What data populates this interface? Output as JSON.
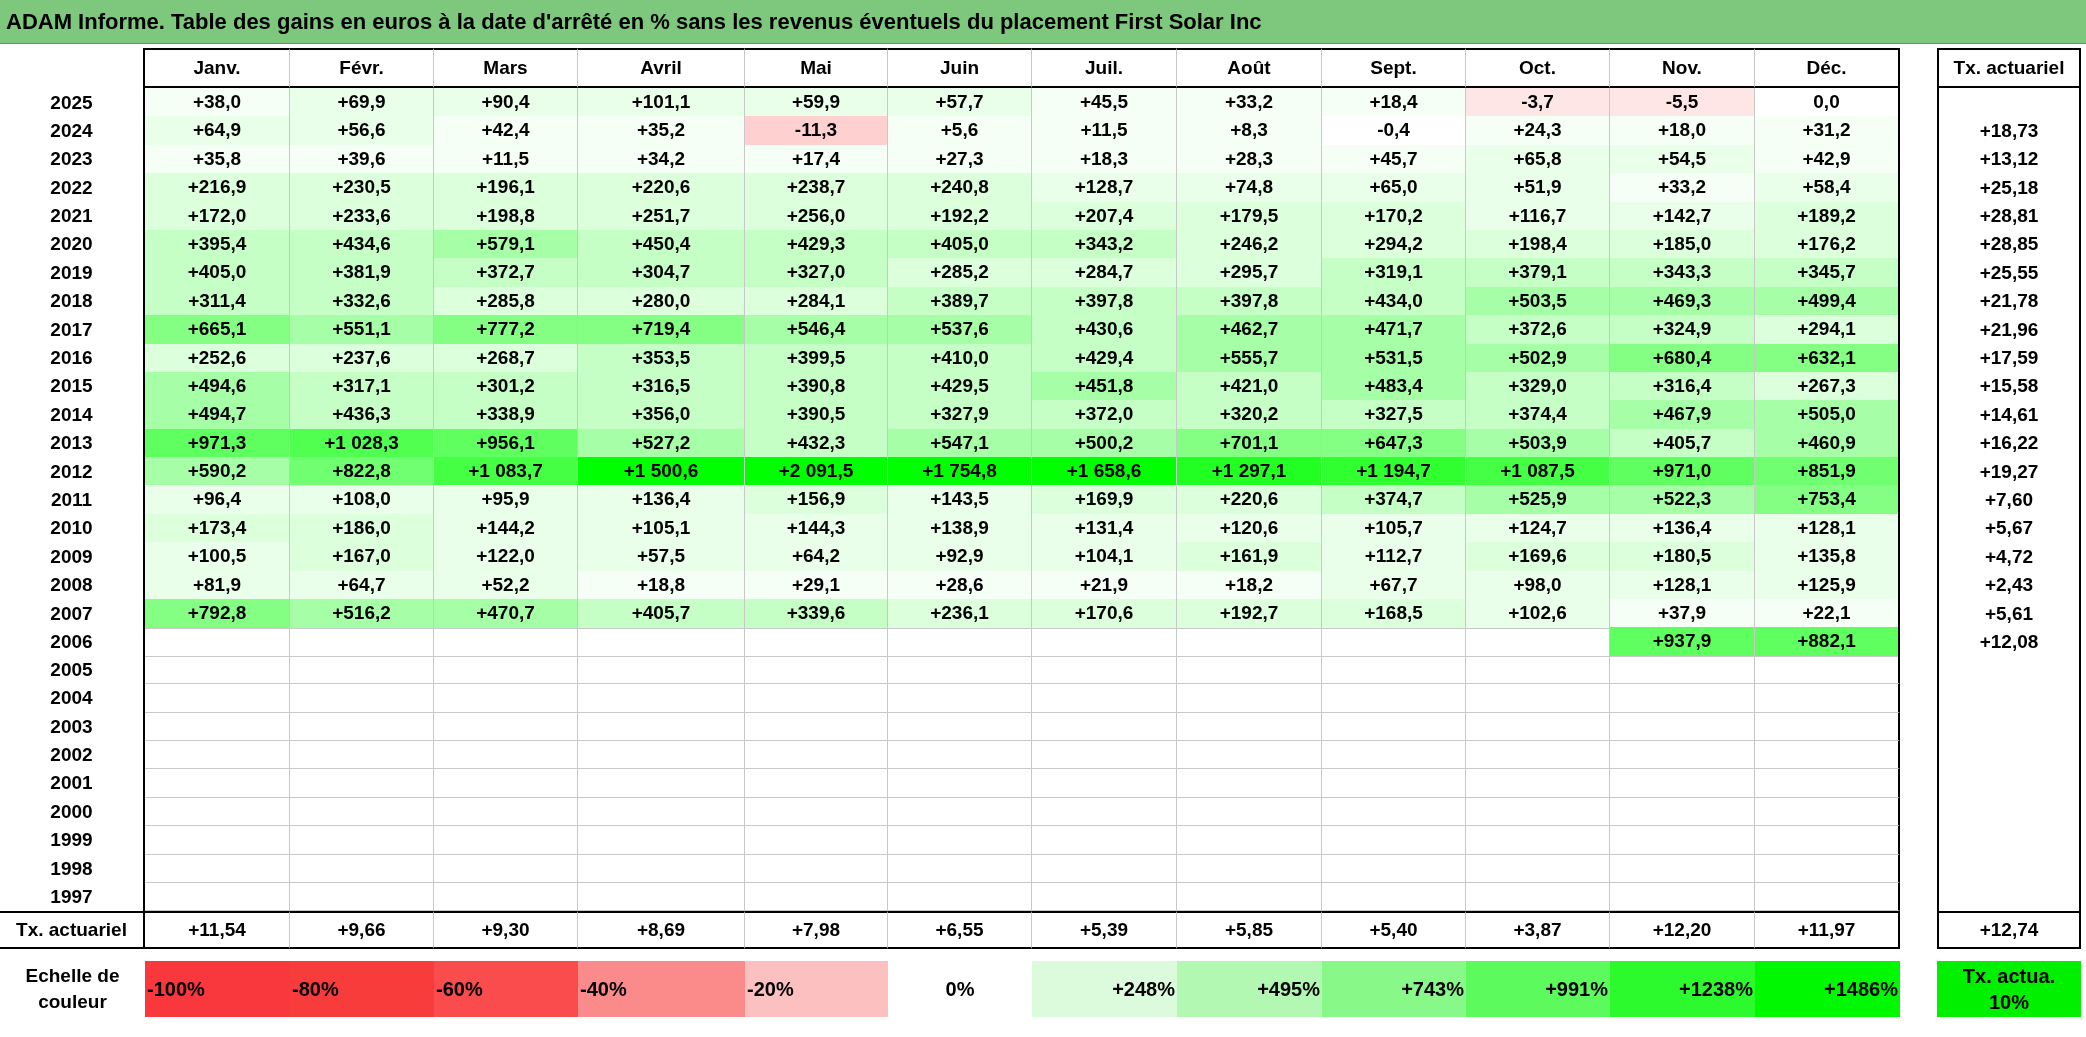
{
  "title": "ADAM Informe. Table des gains en euros à la date d'arrêté en % sans les revenus éventuels du placement First Solar Inc",
  "columns": [
    "Janv.",
    "Févr.",
    "Mars",
    "Avril",
    "Mai",
    "Juin",
    "Juil.",
    "Août",
    "Sept.",
    "Oct.",
    "Nov.",
    "Déc."
  ],
  "tx_header": "Tx. actuariel",
  "rows": [
    {
      "year": "2025",
      "cells": [
        {
          "v": "+38,0",
          "color": "#f6fff6"
        },
        {
          "v": "+69,9",
          "color": "#eaffea"
        },
        {
          "v": "+90,4",
          "color": "#eaffea"
        },
        {
          "v": "+101,1",
          "color": "#eaffea"
        },
        {
          "v": "+59,9",
          "color": "#eaffea"
        },
        {
          "v": "+57,7",
          "color": "#eaffea"
        },
        {
          "v": "+45,5",
          "color": "#f6fff6"
        },
        {
          "v": "+33,2",
          "color": "#f6fff6"
        },
        {
          "v": "+18,4",
          "color": "#f6fff6"
        },
        {
          "v": "-3,7",
          "color": "#ffe6e6"
        },
        {
          "v": "-5,5",
          "color": "#ffe6e6"
        },
        {
          "v": "0,0",
          "color": "#ffffff"
        }
      ]
    },
    {
      "year": "2024",
      "cells": [
        {
          "v": "+64,9",
          "color": "#eaffea"
        },
        {
          "v": "+56,6",
          "color": "#eaffea"
        },
        {
          "v": "+42,4",
          "color": "#f6fff6"
        },
        {
          "v": "+35,2",
          "color": "#f6fff6"
        },
        {
          "v": "-11,3",
          "color": "#ffd0d0"
        },
        {
          "v": "+5,6",
          "color": "#f6fff6"
        },
        {
          "v": "+11,5",
          "color": "#f6fff6"
        },
        {
          "v": "+8,3",
          "color": "#f6fff6"
        },
        {
          "v": "-0,4",
          "color": "#ffffff"
        },
        {
          "v": "+24,3",
          "color": "#f6fff6"
        },
        {
          "v": "+18,0",
          "color": "#f6fff6"
        },
        {
          "v": "+31,2",
          "color": "#f6fff6"
        }
      ],
      "tx": "+18,73"
    },
    {
      "year": "2023",
      "cells": [
        {
          "v": "+35,8",
          "color": "#f6fff6"
        },
        {
          "v": "+39,6",
          "color": "#f6fff6"
        },
        {
          "v": "+11,5",
          "color": "#f6fff6"
        },
        {
          "v": "+34,2",
          "color": "#f6fff6"
        },
        {
          "v": "+17,4",
          "color": "#f6fff6"
        },
        {
          "v": "+27,3",
          "color": "#f6fff6"
        },
        {
          "v": "+18,3",
          "color": "#f6fff6"
        },
        {
          "v": "+28,3",
          "color": "#f6fff6"
        },
        {
          "v": "+45,7",
          "color": "#f6fff6"
        },
        {
          "v": "+65,8",
          "color": "#eaffea"
        },
        {
          "v": "+54,5",
          "color": "#eaffea"
        },
        {
          "v": "+42,9",
          "color": "#f6fff6"
        }
      ],
      "tx": "+13,12"
    },
    {
      "year": "2022",
      "cells": [
        {
          "v": "+216,9",
          "color": "#dcffdc"
        },
        {
          "v": "+230,5",
          "color": "#dcffdc"
        },
        {
          "v": "+196,1",
          "color": "#dcffdc"
        },
        {
          "v": "+220,6",
          "color": "#dcffdc"
        },
        {
          "v": "+238,7",
          "color": "#dcffdc"
        },
        {
          "v": "+240,8",
          "color": "#dcffdc"
        },
        {
          "v": "+128,7",
          "color": "#eaffea"
        },
        {
          "v": "+74,8",
          "color": "#eaffea"
        },
        {
          "v": "+65,0",
          "color": "#eaffea"
        },
        {
          "v": "+51,9",
          "color": "#eaffea"
        },
        {
          "v": "+33,2",
          "color": "#f6fff6"
        },
        {
          "v": "+58,4",
          "color": "#eaffea"
        }
      ],
      "tx": "+25,18"
    },
    {
      "year": "2021",
      "cells": [
        {
          "v": "+172,0",
          "color": "#dcffdc"
        },
        {
          "v": "+233,6",
          "color": "#dcffdc"
        },
        {
          "v": "+198,8",
          "color": "#dcffdc"
        },
        {
          "v": "+251,7",
          "color": "#dcffdc"
        },
        {
          "v": "+256,0",
          "color": "#dcffdc"
        },
        {
          "v": "+192,2",
          "color": "#dcffdc"
        },
        {
          "v": "+207,4",
          "color": "#dcffdc"
        },
        {
          "v": "+179,5",
          "color": "#dcffdc"
        },
        {
          "v": "+170,2",
          "color": "#dcffdc"
        },
        {
          "v": "+116,7",
          "color": "#eaffea"
        },
        {
          "v": "+142,7",
          "color": "#eaffea"
        },
        {
          "v": "+189,2",
          "color": "#dcffdc"
        }
      ],
      "tx": "+28,81"
    },
    {
      "year": "2020",
      "cells": [
        {
          "v": "+395,4",
          "color": "#c6ffc6"
        },
        {
          "v": "+434,6",
          "color": "#c6ffc6"
        },
        {
          "v": "+579,1",
          "color": "#a6ffa6"
        },
        {
          "v": "+450,4",
          "color": "#c6ffc6"
        },
        {
          "v": "+429,3",
          "color": "#c6ffc6"
        },
        {
          "v": "+405,0",
          "color": "#c6ffc6"
        },
        {
          "v": "+343,2",
          "color": "#c6ffc6"
        },
        {
          "v": "+246,2",
          "color": "#dcffdc"
        },
        {
          "v": "+294,2",
          "color": "#dcffdc"
        },
        {
          "v": "+198,4",
          "color": "#dcffdc"
        },
        {
          "v": "+185,0",
          "color": "#dcffdc"
        },
        {
          "v": "+176,2",
          "color": "#dcffdc"
        }
      ],
      "tx": "+28,85"
    },
    {
      "year": "2019",
      "cells": [
        {
          "v": "+405,0",
          "color": "#c6ffc6"
        },
        {
          "v": "+381,9",
          "color": "#c6ffc6"
        },
        {
          "v": "+372,7",
          "color": "#c6ffc6"
        },
        {
          "v": "+304,7",
          "color": "#c6ffc6"
        },
        {
          "v": "+327,0",
          "color": "#c6ffc6"
        },
        {
          "v": "+285,2",
          "color": "#dcffdc"
        },
        {
          "v": "+284,7",
          "color": "#dcffdc"
        },
        {
          "v": "+295,7",
          "color": "#dcffdc"
        },
        {
          "v": "+319,1",
          "color": "#c6ffc6"
        },
        {
          "v": "+379,1",
          "color": "#c6ffc6"
        },
        {
          "v": "+343,3",
          "color": "#c6ffc6"
        },
        {
          "v": "+345,7",
          "color": "#c6ffc6"
        }
      ],
      "tx": "+25,55"
    },
    {
      "year": "2018",
      "cells": [
        {
          "v": "+311,4",
          "color": "#c6ffc6"
        },
        {
          "v": "+332,6",
          "color": "#c6ffc6"
        },
        {
          "v": "+285,8",
          "color": "#dcffdc"
        },
        {
          "v": "+280,0",
          "color": "#dcffdc"
        },
        {
          "v": "+284,1",
          "color": "#dcffdc"
        },
        {
          "v": "+389,7",
          "color": "#c6ffc6"
        },
        {
          "v": "+397,8",
          "color": "#c6ffc6"
        },
        {
          "v": "+397,8",
          "color": "#c6ffc6"
        },
        {
          "v": "+434,0",
          "color": "#c6ffc6"
        },
        {
          "v": "+503,5",
          "color": "#a6ffa6"
        },
        {
          "v": "+469,3",
          "color": "#a6ffa6"
        },
        {
          "v": "+499,4",
          "color": "#a6ffa6"
        }
      ],
      "tx": "+21,78"
    },
    {
      "year": "2017",
      "cells": [
        {
          "v": "+665,1",
          "color": "#84ff84"
        },
        {
          "v": "+551,1",
          "color": "#a6ffa6"
        },
        {
          "v": "+777,2",
          "color": "#84ff84"
        },
        {
          "v": "+719,4",
          "color": "#84ff84"
        },
        {
          "v": "+546,4",
          "color": "#a6ffa6"
        },
        {
          "v": "+537,6",
          "color": "#a6ffa6"
        },
        {
          "v": "+430,6",
          "color": "#c6ffc6"
        },
        {
          "v": "+462,7",
          "color": "#a6ffa6"
        },
        {
          "v": "+471,7",
          "color": "#a6ffa6"
        },
        {
          "v": "+372,6",
          "color": "#c6ffc6"
        },
        {
          "v": "+324,9",
          "color": "#c6ffc6"
        },
        {
          "v": "+294,1",
          "color": "#dcffdc"
        }
      ],
      "tx": "+21,96"
    },
    {
      "year": "2016",
      "cells": [
        {
          "v": "+252,6",
          "color": "#dcffdc"
        },
        {
          "v": "+237,6",
          "color": "#dcffdc"
        },
        {
          "v": "+268,7",
          "color": "#dcffdc"
        },
        {
          "v": "+353,5",
          "color": "#c6ffc6"
        },
        {
          "v": "+399,5",
          "color": "#c6ffc6"
        },
        {
          "v": "+410,0",
          "color": "#c6ffc6"
        },
        {
          "v": "+429,4",
          "color": "#c6ffc6"
        },
        {
          "v": "+555,7",
          "color": "#a6ffa6"
        },
        {
          "v": "+531,5",
          "color": "#a6ffa6"
        },
        {
          "v": "+502,9",
          "color": "#a6ffa6"
        },
        {
          "v": "+680,4",
          "color": "#84ff84"
        },
        {
          "v": "+632,1",
          "color": "#84ff84"
        }
      ],
      "tx": "+17,59"
    },
    {
      "year": "2015",
      "cells": [
        {
          "v": "+494,6",
          "color": "#a6ffa6"
        },
        {
          "v": "+317,1",
          "color": "#c6ffc6"
        },
        {
          "v": "+301,2",
          "color": "#c6ffc6"
        },
        {
          "v": "+316,5",
          "color": "#c6ffc6"
        },
        {
          "v": "+390,8",
          "color": "#c6ffc6"
        },
        {
          "v": "+429,5",
          "color": "#c6ffc6"
        },
        {
          "v": "+451,8",
          "color": "#a6ffa6"
        },
        {
          "v": "+421,0",
          "color": "#c6ffc6"
        },
        {
          "v": "+483,4",
          "color": "#a6ffa6"
        },
        {
          "v": "+329,0",
          "color": "#c6ffc6"
        },
        {
          "v": "+316,4",
          "color": "#c6ffc6"
        },
        {
          "v": "+267,3",
          "color": "#dcffdc"
        }
      ],
      "tx": "+15,58"
    },
    {
      "year": "2014",
      "cells": [
        {
          "v": "+494,7",
          "color": "#a6ffa6"
        },
        {
          "v": "+436,3",
          "color": "#c6ffc6"
        },
        {
          "v": "+338,9",
          "color": "#c6ffc6"
        },
        {
          "v": "+356,0",
          "color": "#c6ffc6"
        },
        {
          "v": "+390,5",
          "color": "#c6ffc6"
        },
        {
          "v": "+327,9",
          "color": "#c6ffc6"
        },
        {
          "v": "+372,0",
          "color": "#c6ffc6"
        },
        {
          "v": "+320,2",
          "color": "#c6ffc6"
        },
        {
          "v": "+327,5",
          "color": "#c6ffc6"
        },
        {
          "v": "+374,4",
          "color": "#c6ffc6"
        },
        {
          "v": "+467,9",
          "color": "#a6ffa6"
        },
        {
          "v": "+505,0",
          "color": "#a6ffa6"
        }
      ],
      "tx": "+14,61"
    },
    {
      "year": "2013",
      "cells": [
        {
          "v": "+971,3",
          "color": "#60ff60"
        },
        {
          "v": "+1 028,3",
          "color": "#50ff50"
        },
        {
          "v": "+956,1",
          "color": "#60ff60"
        },
        {
          "v": "+527,2",
          "color": "#a6ffa6"
        },
        {
          "v": "+432,3",
          "color": "#c6ffc6"
        },
        {
          "v": "+547,1",
          "color": "#a6ffa6"
        },
        {
          "v": "+500,2",
          "color": "#a6ffa6"
        },
        {
          "v": "+701,1",
          "color": "#84ff84"
        },
        {
          "v": "+647,3",
          "color": "#84ff84"
        },
        {
          "v": "+503,9",
          "color": "#a6ffa6"
        },
        {
          "v": "+405,7",
          "color": "#c6ffc6"
        },
        {
          "v": "+460,9",
          "color": "#a6ffa6"
        }
      ],
      "tx": "+16,22"
    },
    {
      "year": "2012",
      "cells": [
        {
          "v": "+590,2",
          "color": "#a6ffa6"
        },
        {
          "v": "+822,8",
          "color": "#70ff70"
        },
        {
          "v": "+1 083,7",
          "color": "#44ff44"
        },
        {
          "v": "+1 500,6",
          "color": "#00ff00"
        },
        {
          "v": "+2 091,5",
          "color": "#00ff00"
        },
        {
          "v": "+1 754,8",
          "color": "#00ff00"
        },
        {
          "v": "+1 658,6",
          "color": "#00ff00"
        },
        {
          "v": "+1 297,1",
          "color": "#22ff22"
        },
        {
          "v": "+1 194,7",
          "color": "#30ff30"
        },
        {
          "v": "+1 087,5",
          "color": "#44ff44"
        },
        {
          "v": "+971,0",
          "color": "#60ff60"
        },
        {
          "v": "+851,9",
          "color": "#70ff70"
        }
      ],
      "tx": "+19,27"
    },
    {
      "year": "2011",
      "cells": [
        {
          "v": "+96,4",
          "color": "#eaffea"
        },
        {
          "v": "+108,0",
          "color": "#eaffea"
        },
        {
          "v": "+95,9",
          "color": "#eaffea"
        },
        {
          "v": "+136,4",
          "color": "#eaffea"
        },
        {
          "v": "+156,9",
          "color": "#dcffdc"
        },
        {
          "v": "+143,5",
          "color": "#eaffea"
        },
        {
          "v": "+169,9",
          "color": "#dcffdc"
        },
        {
          "v": "+220,6",
          "color": "#dcffdc"
        },
        {
          "v": "+374,7",
          "color": "#c6ffc6"
        },
        {
          "v": "+525,9",
          "color": "#a6ffa6"
        },
        {
          "v": "+522,3",
          "color": "#a6ffa6"
        },
        {
          "v": "+753,4",
          "color": "#84ff84"
        }
      ],
      "tx": "+7,60"
    },
    {
      "year": "2010",
      "cells": [
        {
          "v": "+173,4",
          "color": "#dcffdc"
        },
        {
          "v": "+186,0",
          "color": "#dcffdc"
        },
        {
          "v": "+144,2",
          "color": "#eaffea"
        },
        {
          "v": "+105,1",
          "color": "#eaffea"
        },
        {
          "v": "+144,3",
          "color": "#eaffea"
        },
        {
          "v": "+138,9",
          "color": "#eaffea"
        },
        {
          "v": "+131,4",
          "color": "#eaffea"
        },
        {
          "v": "+120,6",
          "color": "#eaffea"
        },
        {
          "v": "+105,7",
          "color": "#eaffea"
        },
        {
          "v": "+124,7",
          "color": "#eaffea"
        },
        {
          "v": "+136,4",
          "color": "#eaffea"
        },
        {
          "v": "+128,1",
          "color": "#eaffea"
        }
      ],
      "tx": "+5,67"
    },
    {
      "year": "2009",
      "cells": [
        {
          "v": "+100,5",
          "color": "#eaffea"
        },
        {
          "v": "+167,0",
          "color": "#dcffdc"
        },
        {
          "v": "+122,0",
          "color": "#eaffea"
        },
        {
          "v": "+57,5",
          "color": "#eaffea"
        },
        {
          "v": "+64,2",
          "color": "#eaffea"
        },
        {
          "v": "+92,9",
          "color": "#eaffea"
        },
        {
          "v": "+104,1",
          "color": "#eaffea"
        },
        {
          "v": "+161,9",
          "color": "#dcffdc"
        },
        {
          "v": "+112,7",
          "color": "#eaffea"
        },
        {
          "v": "+169,6",
          "color": "#dcffdc"
        },
        {
          "v": "+180,5",
          "color": "#dcffdc"
        },
        {
          "v": "+135,8",
          "color": "#eaffea"
        }
      ],
      "tx": "+4,72"
    },
    {
      "year": "2008",
      "cells": [
        {
          "v": "+81,9",
          "color": "#eaffea"
        },
        {
          "v": "+64,7",
          "color": "#eaffea"
        },
        {
          "v": "+52,2",
          "color": "#eaffea"
        },
        {
          "v": "+18,8",
          "color": "#f6fff6"
        },
        {
          "v": "+29,1",
          "color": "#f6fff6"
        },
        {
          "v": "+28,6",
          "color": "#f6fff6"
        },
        {
          "v": "+21,9",
          "color": "#f6fff6"
        },
        {
          "v": "+18,2",
          "color": "#f6fff6"
        },
        {
          "v": "+67,7",
          "color": "#eaffea"
        },
        {
          "v": "+98,0",
          "color": "#eaffea"
        },
        {
          "v": "+128,1",
          "color": "#eaffea"
        },
        {
          "v": "+125,9",
          "color": "#eaffea"
        }
      ],
      "tx": "+2,43"
    },
    {
      "year": "2007",
      "cells": [
        {
          "v": "+792,8",
          "color": "#84ff84"
        },
        {
          "v": "+516,2",
          "color": "#a6ffa6"
        },
        {
          "v": "+470,7",
          "color": "#a6ffa6"
        },
        {
          "v": "+405,7",
          "color": "#c6ffc6"
        },
        {
          "v": "+339,6",
          "color": "#c6ffc6"
        },
        {
          "v": "+236,1",
          "color": "#dcffdc"
        },
        {
          "v": "+170,6",
          "color": "#dcffdc"
        },
        {
          "v": "+192,7",
          "color": "#dcffdc"
        },
        {
          "v": "+168,5",
          "color": "#dcffdc"
        },
        {
          "v": "+102,6",
          "color": "#eaffea"
        },
        {
          "v": "+37,9",
          "color": "#f6fff6"
        },
        {
          "v": "+22,1",
          "color": "#f6fff6"
        }
      ],
      "tx": "+5,61"
    },
    {
      "year": "2006",
      "cells": [
        null,
        null,
        null,
        null,
        null,
        null,
        null,
        null,
        null,
        null,
        {
          "v": "+937,9",
          "color": "#60ff60"
        },
        {
          "v": "+882,1",
          "color": "#60ff60"
        }
      ],
      "tx": "+12,08"
    },
    {
      "year": "2005"
    },
    {
      "year": "2004"
    },
    {
      "year": "2003"
    },
    {
      "year": "2002"
    },
    {
      "year": "2001"
    },
    {
      "year": "2000"
    },
    {
      "year": "1999"
    },
    {
      "year": "1998"
    },
    {
      "year": "1997"
    }
  ],
  "footer": {
    "label": "Tx. actuariel",
    "values": [
      "+11,54",
      "+9,66",
      "+9,30",
      "+8,69",
      "+7,98",
      "+6,55",
      "+5,39",
      "+5,85",
      "+5,40",
      "+3,87",
      "+12,20",
      "+11,97"
    ],
    "total": "+12,74"
  },
  "legend": {
    "label": "Echelle de couleur",
    "items": [
      {
        "label": "-100%",
        "kind": "negative",
        "color": "#f8383c"
      },
      {
        "label": "-80%",
        "kind": "negative",
        "color": "#f83c3c"
      },
      {
        "label": "-60%",
        "kind": "negative",
        "color": "#fa4c4c"
      },
      {
        "label": "-40%",
        "kind": "negative",
        "color": "#fb8a8a"
      },
      {
        "label": "-20%",
        "kind": "negative",
        "color": "#fcc0c0"
      },
      {
        "label": "0%",
        "kind": "zero",
        "color": "#ffffff"
      },
      {
        "label": "+248%",
        "kind": "positive",
        "color": "#dcfadc"
      },
      {
        "label": "+495%",
        "kind": "positive",
        "color": "#b2f8b2"
      },
      {
        "label": "+743%",
        "kind": "positive",
        "color": "#88f888"
      },
      {
        "label": "+991%",
        "kind": "positive",
        "color": "#5cfa5c"
      },
      {
        "label": "+1238%",
        "kind": "positive",
        "color": "#2cfa2c"
      },
      {
        "label": "+1486%",
        "kind": "positive",
        "color": "#00f800"
      }
    ],
    "tx_box": {
      "label": "Tx. actua. 10%",
      "color": "#00f000"
    }
  }
}
